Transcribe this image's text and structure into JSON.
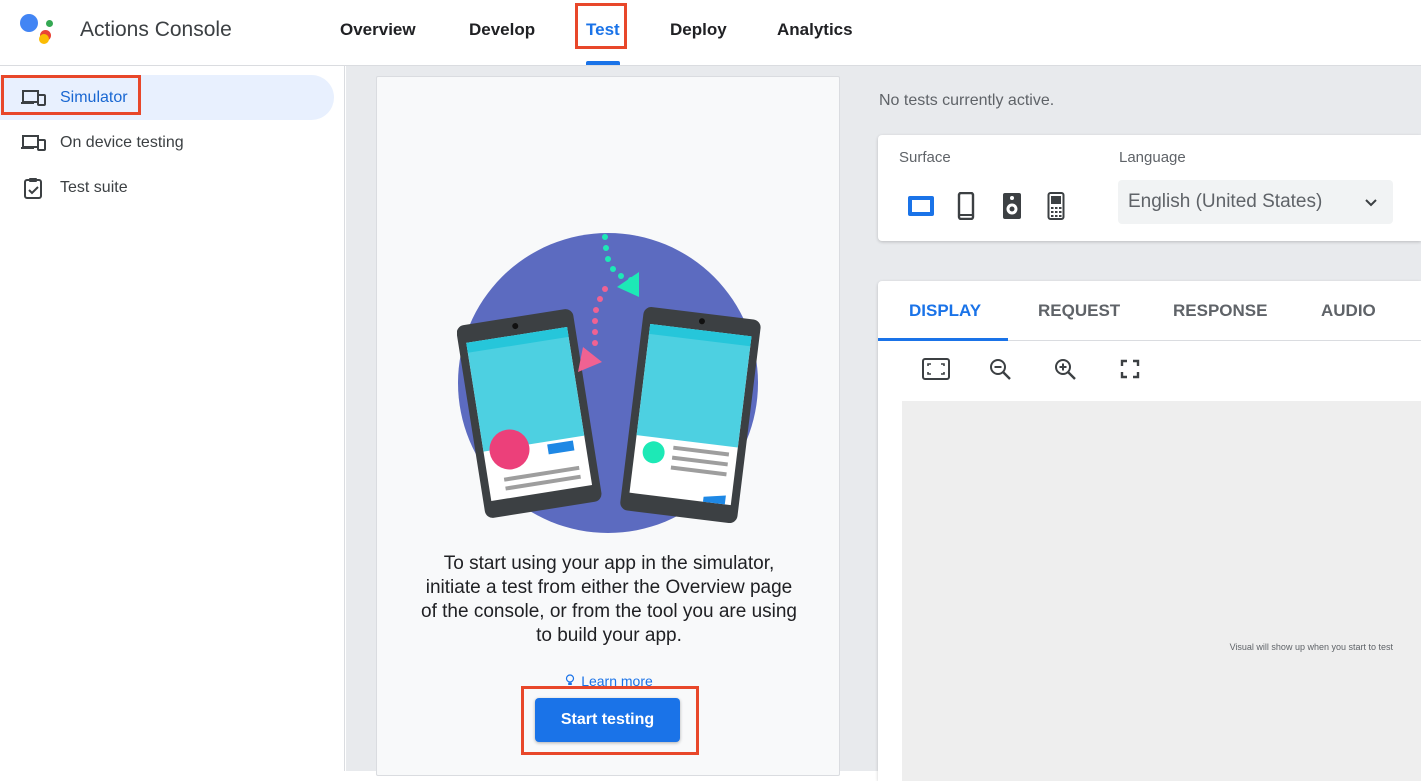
{
  "header": {
    "app_title": "Actions Console",
    "nav": [
      {
        "label": "Overview"
      },
      {
        "label": "Develop"
      },
      {
        "label": "Test"
      },
      {
        "label": "Deploy"
      },
      {
        "label": "Analytics"
      }
    ],
    "active_nav": "Test"
  },
  "sidebar": {
    "items": [
      {
        "label": "Simulator",
        "icon": "devices-icon"
      },
      {
        "label": "On device testing",
        "icon": "devices-icon"
      },
      {
        "label": "Test suite",
        "icon": "clipboard-check-icon"
      }
    ],
    "active_item": "Simulator"
  },
  "simulator_card": {
    "message": "To start using your app in the simulator, initiate a test from either the Overview page of the console, or from the tool you are using to build your app.",
    "learn_more": "Learn more",
    "start_button": "Start testing"
  },
  "status": {
    "text": "No tests currently active."
  },
  "settings": {
    "surface_label": "Surface",
    "surface_icons": [
      "smart-display-icon",
      "phone-icon",
      "speaker-icon",
      "kaios-phone-icon"
    ],
    "language_label": "Language",
    "language_value": "English (United States)"
  },
  "output_panel": {
    "tabs": [
      "DISPLAY",
      "REQUEST",
      "RESPONSE",
      "AUDIO"
    ],
    "active_tab": "DISPLAY",
    "tools": [
      "fit-screen-icon",
      "zoom-out-icon",
      "zoom-in-icon",
      "fullscreen-icon"
    ],
    "placeholder": "Visual will show up when you start to test"
  },
  "colors": {
    "accent": "#1a73e8",
    "highlight": "#e8472a",
    "illustration_bg": "#5c6bc0"
  }
}
